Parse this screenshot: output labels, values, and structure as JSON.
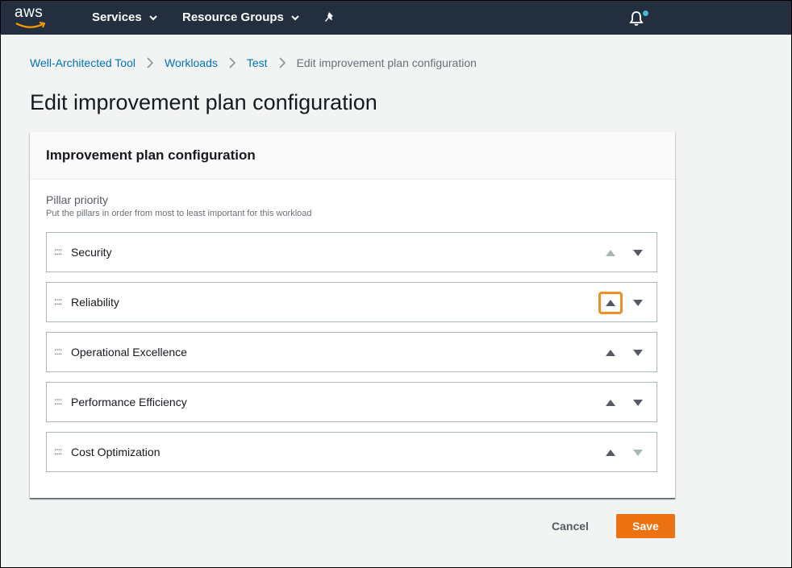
{
  "nav": {
    "logo_text": "aws",
    "services_label": "Services",
    "resource_groups_label": "Resource Groups",
    "notification_dot_color": "#44b9d6"
  },
  "breadcrumb": {
    "items": [
      "Well-Architected Tool",
      "Workloads",
      "Test"
    ],
    "current": "Edit improvement plan configuration"
  },
  "page": {
    "title": "Edit improvement plan configuration"
  },
  "panel": {
    "title": "Improvement plan configuration",
    "field_label": "Pillar priority",
    "field_description": "Put the pillars in order from most to least important for this workload",
    "drag_handle": "::::",
    "pillars": [
      {
        "label": "Security",
        "up_enabled": false,
        "down_enabled": true
      },
      {
        "label": "Reliability",
        "up_enabled": true,
        "down_enabled": true,
        "up_focused": true
      },
      {
        "label": "Operational Excellence",
        "up_enabled": true,
        "down_enabled": true
      },
      {
        "label": "Performance Efficiency",
        "up_enabled": true,
        "down_enabled": true
      },
      {
        "label": "Cost Optimization",
        "up_enabled": true,
        "down_enabled": false
      }
    ]
  },
  "actions": {
    "cancel_label": "Cancel",
    "save_label": "Save",
    "save_color": "#ec7211"
  }
}
